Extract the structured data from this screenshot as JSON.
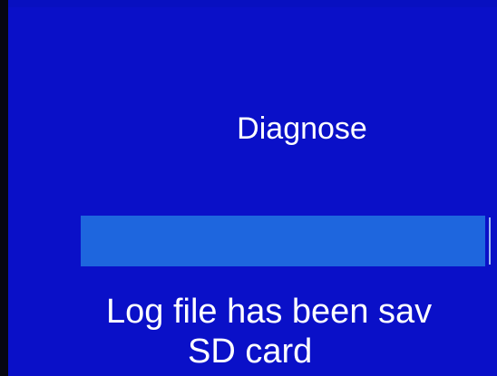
{
  "screen": {
    "title": "Diagnose",
    "progress_percent": 100,
    "message_line1": "Log file has been sav",
    "message_line2": "SD card"
  },
  "colors": {
    "background": "#0a10c8",
    "progress": "#1e66de",
    "text": "#ffffff"
  }
}
